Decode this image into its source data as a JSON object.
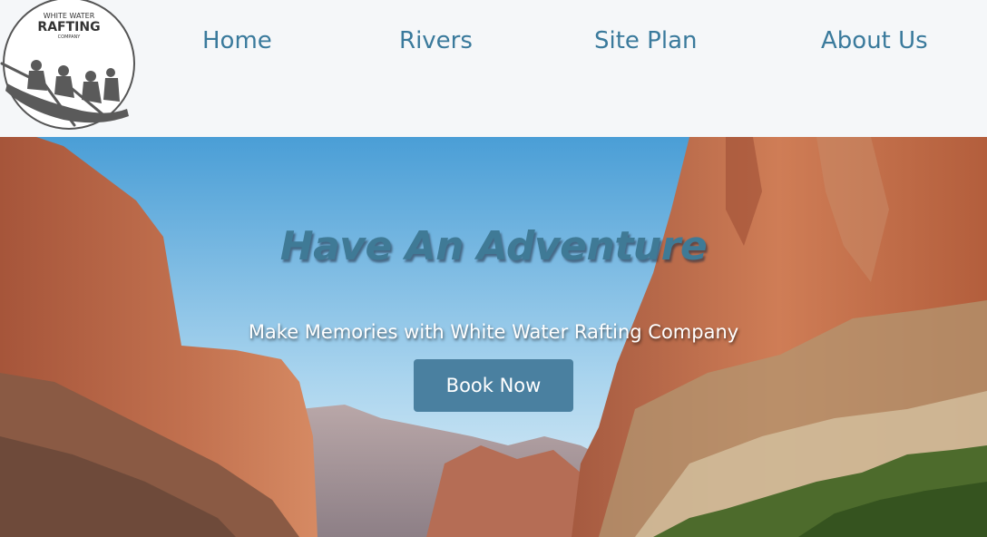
{
  "logo": {
    "line1": "WHITE WATER",
    "line2": "RAFTING",
    "line3": "COMPANY"
  },
  "nav": {
    "items": [
      {
        "label": "Home"
      },
      {
        "label": "Rivers"
      },
      {
        "label": "Site Plan"
      },
      {
        "label": "About Us"
      }
    ]
  },
  "hero": {
    "title": "Have An Adventure",
    "subtitle": "Make Memories with White Water Rafting Company",
    "cta_label": "Book Now"
  },
  "colors": {
    "nav_text": "#3a7a9c",
    "title": "#3f7a96",
    "button_bg": "#4a80a0",
    "header_bg": "#f5f7f9"
  }
}
